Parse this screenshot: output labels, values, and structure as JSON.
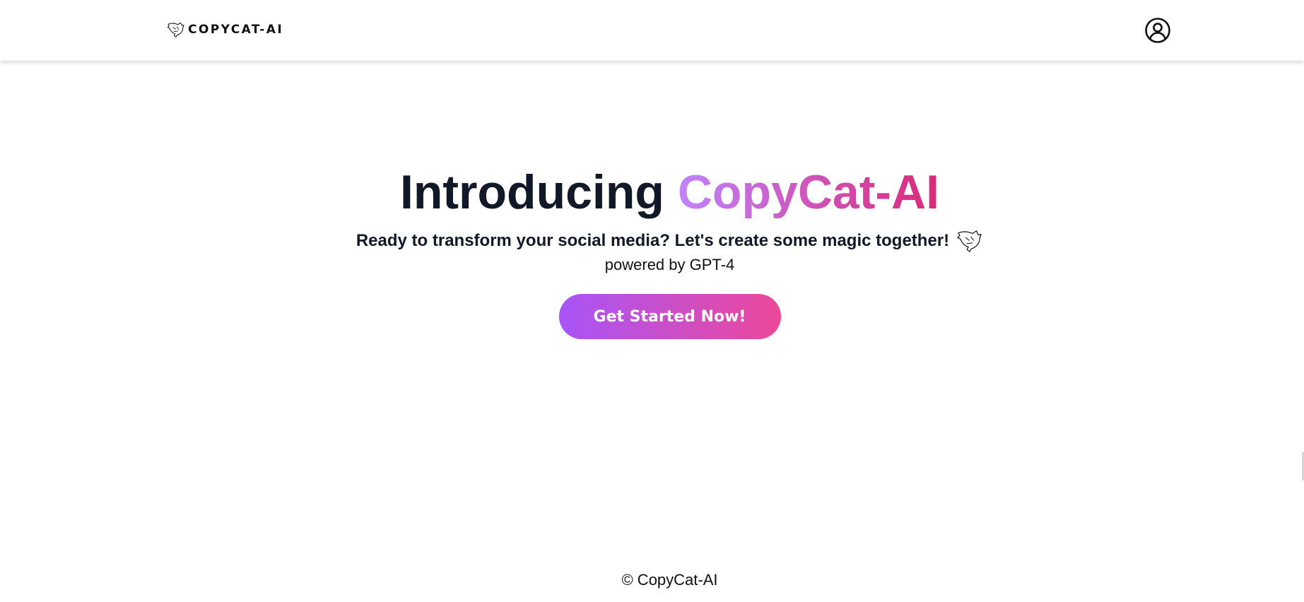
{
  "header": {
    "brand_name": "COPYCAT-AI",
    "logo_icon": "cat-doodle-icon",
    "profile_icon": "user-circle-icon"
  },
  "hero": {
    "title_prefix": "Introducing",
    "title_accent": "CopyCat-AI",
    "subtitle": "Ready to transform your social media? Let's create some magic together!",
    "subtitle_icon": "cat-doodle-icon",
    "powered_by": "powered by GPT-4",
    "cta_label": "Get Started Now!"
  },
  "footer": {
    "copyright": "© CopyCat-AI"
  },
  "colors": {
    "text_dark": "#111827",
    "accent_gradient_start": "#c084fc",
    "accent_gradient_end": "#db2777",
    "button_gradient_start": "#a855f7",
    "button_gradient_end": "#ec4899",
    "background": "#ffffff"
  }
}
